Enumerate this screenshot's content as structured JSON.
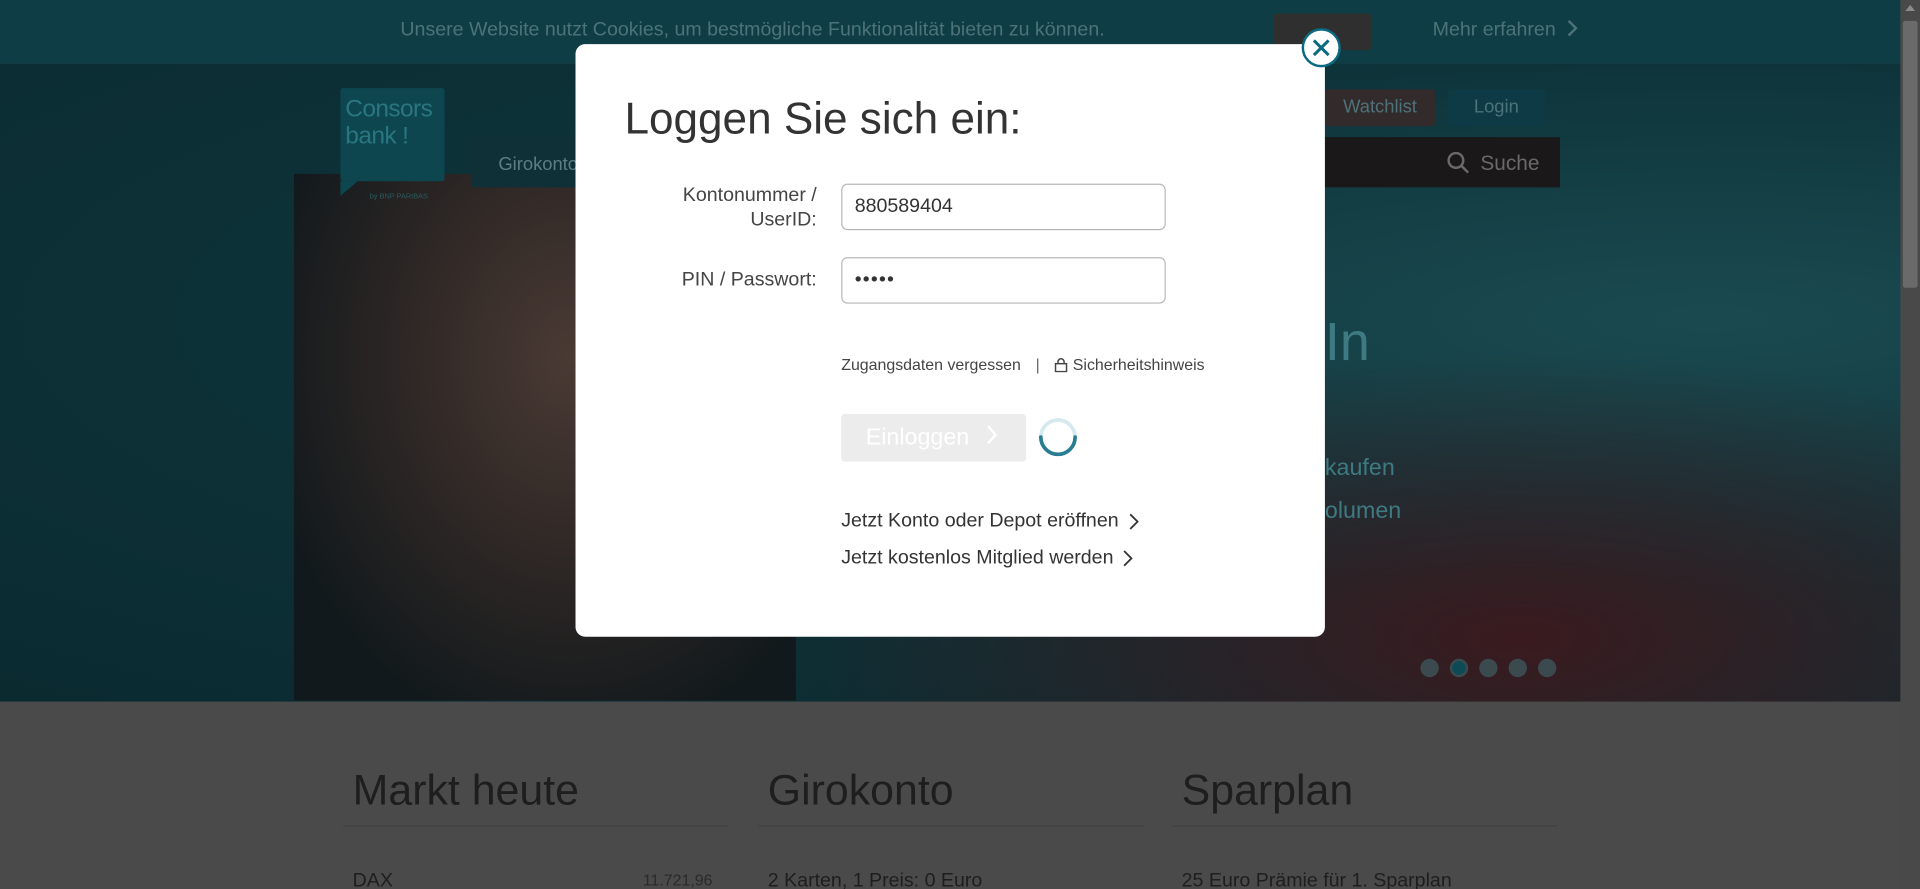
{
  "cookie_bar": {
    "text": "Unsere Website nutzt Cookies, um bestmögliche Funktionalität bieten zu können.",
    "more_label": "Mehr erfahren"
  },
  "header": {
    "logo_line1": "Consors",
    "logo_line2": "bank !",
    "logo_sub": "by BNP PARIBAS",
    "nav_first": "Girokonto",
    "watchlist_label": "Watchlist",
    "login_label": "Login",
    "search_label": "Suche"
  },
  "hero": {
    "big_text": "In",
    "line1": "kaufen",
    "line2": "olumen",
    "slides": [
      false,
      true,
      false,
      false,
      false
    ]
  },
  "lower": {
    "columns": [
      {
        "title": "Markt heute",
        "text": "DAX",
        "value": "11.721,96"
      },
      {
        "title": "Girokonto",
        "text": "2 Karten, 1 Preis: 0 Euro"
      },
      {
        "title": "Sparplan",
        "text": "25 Euro Prämie für 1. Sparplan"
      }
    ]
  },
  "modal": {
    "title": "Loggen Sie sich ein:",
    "account_label_1": "Kontonummer /",
    "account_label_2": "UserID:",
    "account_value": "880589404",
    "pin_label": "PIN / Passwort:",
    "pin_value": "•••••",
    "forgot_label": "Zugangsdaten vergessen",
    "separator": "|",
    "security_label": "Sicherheitshinweis",
    "submit_label": "Einloggen",
    "open_account_label": "Jetzt Konto oder Depot eröffnen",
    "member_label": "Jetzt kostenlos Mitglied werden"
  },
  "colors": {
    "accent": "#0b6a80",
    "cookie_bg": "#0f3d45",
    "modal_bg": "#ffffff"
  }
}
